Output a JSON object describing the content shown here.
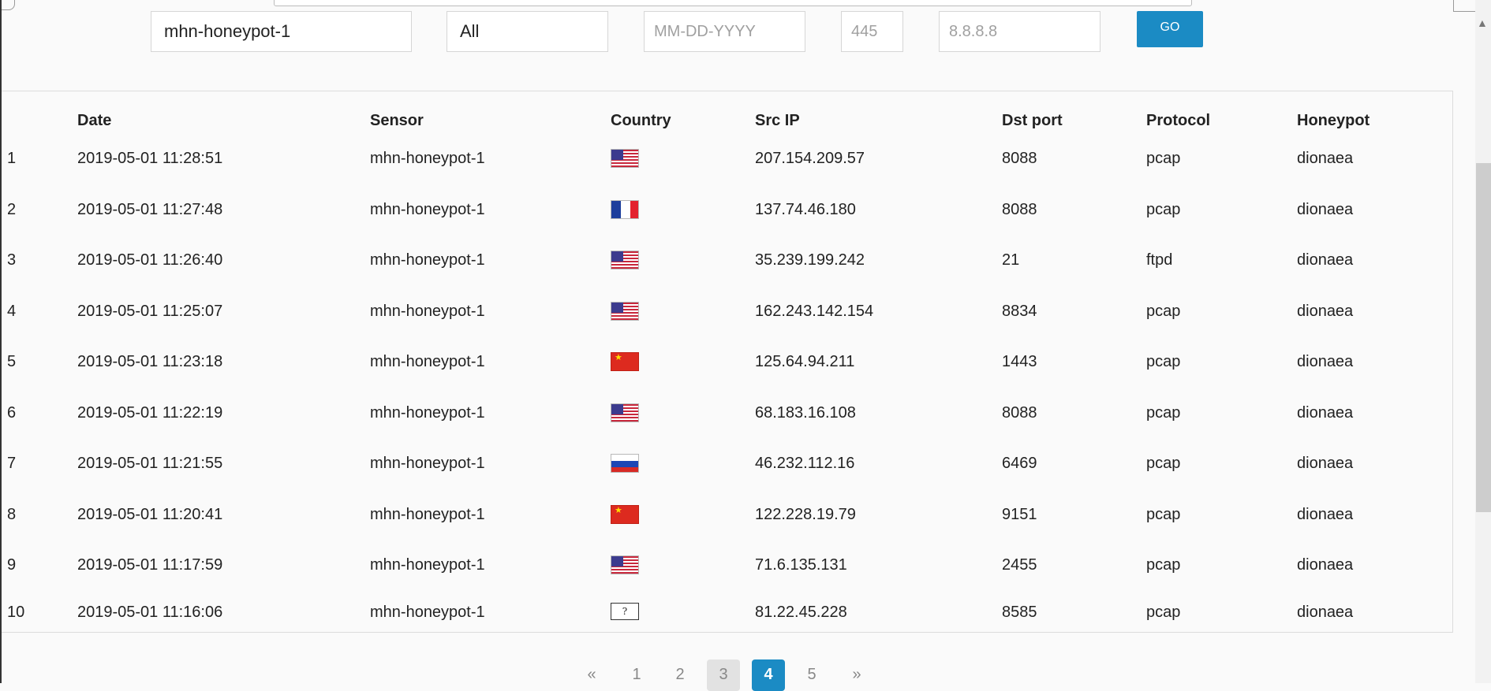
{
  "filters": {
    "sensor_value": "mhn-honeypot-1",
    "honeypot_value": "All",
    "date_placeholder": "MM-DD-YYYY",
    "port_placeholder": "445",
    "ip_placeholder": "8.8.8.8",
    "go_label": "GO"
  },
  "table": {
    "headers": {
      "date": "Date",
      "sensor": "Sensor",
      "country": "Country",
      "src_ip": "Src IP",
      "dst_port": "Dst port",
      "protocol": "Protocol",
      "honeypot": "Honeypot"
    },
    "rows": [
      {
        "num": "1",
        "date": "2019-05-01 11:28:51",
        "sensor": "mhn-honeypot-1",
        "country": "us-flag-icon",
        "src_ip": "207.154.209.57",
        "dst_port": "8088",
        "protocol": "pcap",
        "honeypot": "dionaea"
      },
      {
        "num": "2",
        "date": "2019-05-01 11:27:48",
        "sensor": "mhn-honeypot-1",
        "country": "fr-flag-icon",
        "src_ip": "137.74.46.180",
        "dst_port": "8088",
        "protocol": "pcap",
        "honeypot": "dionaea"
      },
      {
        "num": "3",
        "date": "2019-05-01 11:26:40",
        "sensor": "mhn-honeypot-1",
        "country": "us-flag-icon",
        "src_ip": "35.239.199.242",
        "dst_port": "21",
        "protocol": "ftpd",
        "honeypot": "dionaea"
      },
      {
        "num": "4",
        "date": "2019-05-01 11:25:07",
        "sensor": "mhn-honeypot-1",
        "country": "us-flag-icon",
        "src_ip": "162.243.142.154",
        "dst_port": "8834",
        "protocol": "pcap",
        "honeypot": "dionaea"
      },
      {
        "num": "5",
        "date": "2019-05-01 11:23:18",
        "sensor": "mhn-honeypot-1",
        "country": "cn-flag-icon",
        "src_ip": "125.64.94.211",
        "dst_port": "1443",
        "protocol": "pcap",
        "honeypot": "dionaea"
      },
      {
        "num": "6",
        "date": "2019-05-01 11:22:19",
        "sensor": "mhn-honeypot-1",
        "country": "us-flag-icon",
        "src_ip": "68.183.16.108",
        "dst_port": "8088",
        "protocol": "pcap",
        "honeypot": "dionaea"
      },
      {
        "num": "7",
        "date": "2019-05-01 11:21:55",
        "sensor": "mhn-honeypot-1",
        "country": "ru-flag-icon",
        "src_ip": "46.232.112.16",
        "dst_port": "6469",
        "protocol": "pcap",
        "honeypot": "dionaea"
      },
      {
        "num": "8",
        "date": "2019-05-01 11:20:41",
        "sensor": "mhn-honeypot-1",
        "country": "cn-flag-icon",
        "src_ip": "122.228.19.79",
        "dst_port": "9151",
        "protocol": "pcap",
        "honeypot": "dionaea"
      },
      {
        "num": "9",
        "date": "2019-05-01 11:17:59",
        "sensor": "mhn-honeypot-1",
        "country": "us-flag-icon",
        "src_ip": "71.6.135.131",
        "dst_port": "2455",
        "protocol": "pcap",
        "honeypot": "dionaea"
      },
      {
        "num": "10",
        "date": "2019-05-01 11:16:06",
        "sensor": "mhn-honeypot-1",
        "country": "unknown-flag-icon",
        "src_ip": "81.22.45.228",
        "dst_port": "8585",
        "protocol": "pcap",
        "honeypot": "dionaea"
      }
    ],
    "unknown_flag_text": "?"
  },
  "pagination": {
    "prev": "«",
    "pages": [
      "1",
      "2",
      "3",
      "4",
      "5"
    ],
    "current": "4",
    "next": "»"
  },
  "colors": {
    "accent": "#1b8bc4"
  }
}
